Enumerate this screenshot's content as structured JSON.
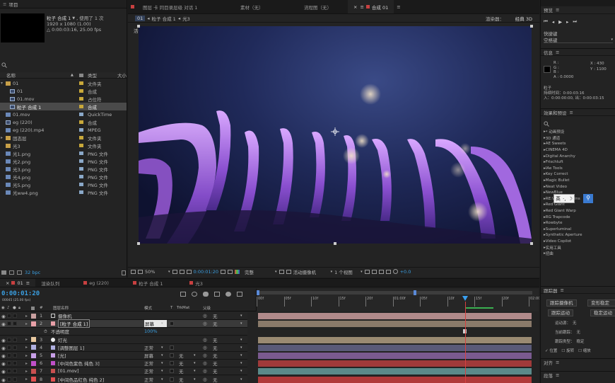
{
  "project": {
    "panel_title": "项目",
    "comp_name": "粒子 合成 1",
    "used_count": ", 使用了 1 次",
    "comp_size": "1920 x 1080 (1.00)",
    "comp_duration": "△ 0:00:03:16, 25.00 fps",
    "search_icon": "magnify",
    "col_name": "名称",
    "col_type": "类型",
    "col_size": "大小",
    "items": [
      {
        "name": "01",
        "type": "文件夹",
        "color": "#c8a83a",
        "icon": "folder",
        "indent": 0,
        "exp": "▾"
      },
      {
        "name": "01",
        "type": "合成",
        "color": "#c8a83a",
        "icon": "comp",
        "indent": 1,
        "exp": ""
      },
      {
        "name": "01.mov",
        "type": "占位符",
        "color": "#c8a83a",
        "icon": "comp",
        "indent": 1,
        "exp": ""
      },
      {
        "name": "粒子 合成 1",
        "type": "合成",
        "color": "#c8a83a",
        "icon": "comp",
        "indent": 1,
        "exp": "",
        "selected": true
      },
      {
        "name": "01.mov",
        "type": "QuickTime",
        "color": "#8aa8c8",
        "icon": "file",
        "indent": 0,
        "exp": ""
      },
      {
        "name": "eg (220)",
        "type": "合成",
        "color": "#c8a83a",
        "icon": "comp",
        "indent": 0,
        "exp": ""
      },
      {
        "name": "eg (220).mp4",
        "type": "MPEG",
        "color": "#8aa8c8",
        "icon": "file",
        "indent": 0,
        "exp": ""
      },
      {
        "name": "固态层",
        "type": "文件夹",
        "color": "#c8a83a",
        "icon": "folder",
        "indent": 0,
        "exp": "▸"
      },
      {
        "name": "光3",
        "type": "文件夹",
        "color": "#c8a83a",
        "icon": "folder",
        "indent": 0,
        "exp": ""
      },
      {
        "name": "光1.png",
        "type": "PNG 文件",
        "color": "#8aa8c8",
        "icon": "file",
        "indent": 0,
        "exp": ""
      },
      {
        "name": "光2.png",
        "type": "PNG 文件",
        "color": "#8aa8c8",
        "icon": "file",
        "indent": 0,
        "exp": ""
      },
      {
        "name": "光3.png",
        "type": "PNG 文件",
        "color": "#8aa8c8",
        "icon": "file",
        "indent": 0,
        "exp": ""
      },
      {
        "name": "光4.png",
        "type": "PNG 文件",
        "color": "#8aa8c8",
        "icon": "file",
        "indent": 0,
        "exp": ""
      },
      {
        "name": "光5.png",
        "type": "PNG 文件",
        "color": "#8aa8c8",
        "icon": "file",
        "indent": 0,
        "exp": ""
      },
      {
        "name": "光ww4.png",
        "type": "PNG 文件",
        "color": "#8aa8c8",
        "icon": "file",
        "indent": 0,
        "exp": ""
      }
    ],
    "bpc": "32 bpc"
  },
  "viewer": {
    "tabs": [
      "图层（无）",
      "素材（无）",
      "流程图（无）",
      "合成 01"
    ],
    "tab_prefix": "图层 卡 同目录层级 对话 1",
    "breadcrumbs": [
      "01",
      "粒子 合成 1",
      "光3"
    ],
    "renderer_label": "渲染器：",
    "renderer": "经典 3D",
    "camera_label": "活动摄像机",
    "zoom": "50%",
    "timecode": "0:00:01:20",
    "quality": "完整",
    "view": "活动摄像机",
    "views": "1 个视图",
    "exposure": "+0.0"
  },
  "info": {
    "title": "信息",
    "r": "R :",
    "g": "G :",
    "b": "B :",
    "a": "A : 0.0000",
    "x": "X : 430",
    "y": "Y : 1100",
    "layer_name": "粒子",
    "duration": "持续时间：0:00:03:16",
    "inout": "入：0:00:00:00, 出：0:00:03:15"
  },
  "preview": {
    "title": "预览",
    "shortcut_label": "快捷键",
    "shortcut": "空格键"
  },
  "effects": {
    "title": "效果和预设",
    "items": [
      "* 动画预设",
      "3D 通道",
      "AE Sweets",
      "CINEMA 4D",
      "Digital Anarchy",
      "Frischluft",
      "IAe Tools",
      "Key Correct",
      "Magic Bullet",
      "Neat Video",
      "NewBlue",
      "RE:Vision Plug-ins",
      "Red Giant",
      "Red Giant Warp",
      "RG Trapcode",
      "Rowbyte",
      "Superluminal",
      "Synthetic Aperture",
      "Video Copilot",
      "实用工具",
      "扭曲"
    ]
  },
  "ime": {
    "label": "英",
    "sym": "·,"
  },
  "tracker": {
    "title": "跟踪器",
    "btn_camera": "跟踪摄像机",
    "btn_warp": "变形稳定器",
    "btn_motion": "跟踪运动",
    "btn_stab": "稳定运动",
    "src_label": "运动源：",
    "src": "无",
    "cur_label": "当前跟踪：",
    "cur": "无",
    "type_label": "跟踪类型：",
    "type": "稳定",
    "opt1": "位置",
    "opt2": "旋转",
    "opt3": "缩放"
  },
  "align_title": "对齐",
  "para_title": "段落",
  "timeline": {
    "tabs": [
      "01",
      "渲染队列",
      "eg (220)",
      "粒子 合成 1",
      "光3"
    ],
    "timecode": "0:00:01:20",
    "fps": "00045 (25.00 fps)",
    "col_name": "图层名称",
    "col_mode": "模式",
    "col_t": "T",
    "col_trkmat": "TrkMat",
    "col_parent": "父级",
    "ruler": [
      "00f",
      "05f",
      "10f",
      "15f",
      "20f",
      "01:00f",
      "05f",
      "10f",
      "15f",
      "20f",
      "02:00f"
    ],
    "layers": [
      {
        "num": "1",
        "name": "摄像机",
        "color": "#c9a0a0",
        "mode": "",
        "trkmat": "",
        "parent": "无",
        "bar": "#b08a8a",
        "icon": "cam",
        "bold": false
      },
      {
        "num": "2",
        "name": "[粒子 合成 1]",
        "color": "#e8a0a8",
        "mode": "屏幕",
        "trkmat": "",
        "parent": "无",
        "bar": "#8a7a6a",
        "icon": "comp",
        "bold": false,
        "selected": true
      },
      {
        "num": "",
        "name": "不透明度",
        "color": "",
        "mode": "100%",
        "trkmat": "",
        "parent": "",
        "bar": "",
        "icon": "prop",
        "bold": false
      },
      {
        "num": "3",
        "name": "灯光",
        "color": "#e8c8a0",
        "mode": "",
        "trkmat": "",
        "parent": "无",
        "bar": "#9a8a72",
        "icon": "light",
        "bold": false
      },
      {
        "num": "4",
        "name": "[调整图层 1]",
        "color": "#b0b0e0",
        "mode": "正常",
        "trkmat": "",
        "parent": "无",
        "bar": "#5a5a78",
        "icon": "adj",
        "bold": false
      },
      {
        "num": "5",
        "name": "[光]",
        "color": "#c8a0e8",
        "mode": "屏幕",
        "trkmat": "无",
        "parent": "无",
        "bar": "#7a5a90",
        "icon": "solid",
        "bold": false
      },
      {
        "num": "6",
        "name": "[中间色紫色 纯色 3]",
        "color": "#c050c8",
        "mode": "正常",
        "trkmat": "无",
        "parent": "无",
        "bar": "#a03a3a",
        "icon": "solid",
        "bold": false
      },
      {
        "num": "7",
        "name": "[01.mov]",
        "color": "#c85050",
        "mode": "正常",
        "trkmat": "无",
        "parent": "无",
        "bar": "#5a8a8a",
        "icon": "file",
        "bold": false
      },
      {
        "num": "8",
        "name": "[中间色品红色 纯色 2]",
        "color": "#e05050",
        "mode": "正常",
        "trkmat": "无",
        "parent": "无",
        "bar": "#b03a3a",
        "icon": "solid",
        "bold": false
      }
    ]
  }
}
